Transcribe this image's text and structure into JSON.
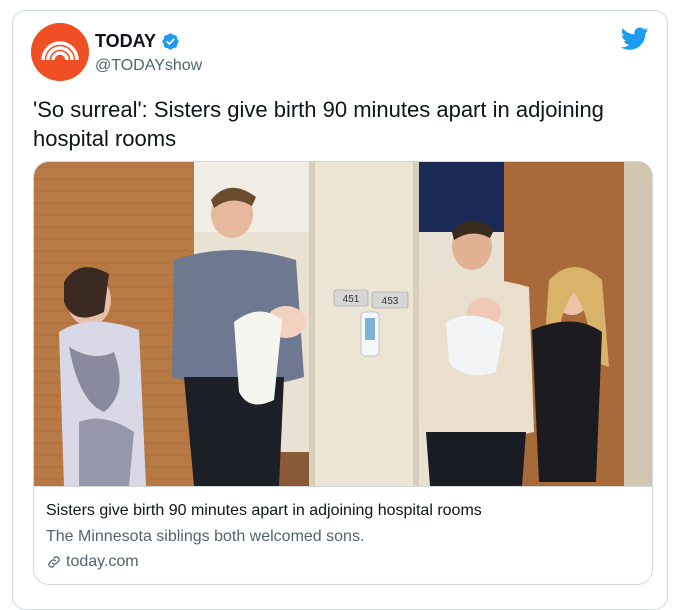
{
  "author": {
    "name": "TODAY",
    "handle": "@TODAYshow",
    "avatar_icon": "today-logo-icon",
    "brand_color": "#f04e24",
    "verified": true
  },
  "tweet": {
    "text": "'So surreal': Sisters give birth 90 minutes apart in adjoining hospital rooms"
  },
  "card": {
    "image_alt": "photo-two-couples-holding-newborns",
    "room_labels": [
      "451",
      "453"
    ],
    "title": "Sisters give birth 90 minutes apart in adjoining hospital rooms",
    "description": "The Minnesota siblings both welcomed sons.",
    "domain": "today.com",
    "domain_icon": "link-icon"
  },
  "colors": {
    "text": "#0f1419",
    "secondary": "#536471",
    "border": "#cfd9de",
    "twitter_blue": "#1d9bf0"
  }
}
